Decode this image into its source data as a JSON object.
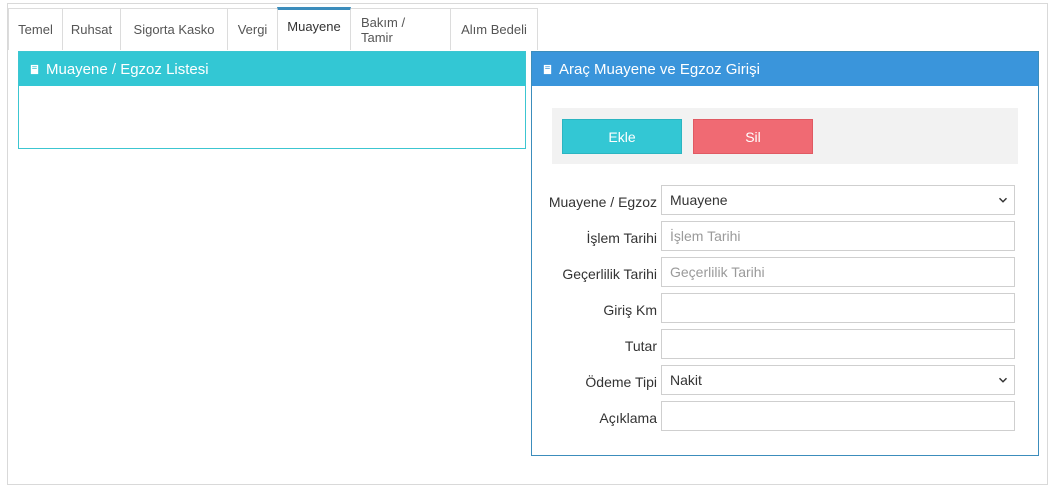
{
  "tabs": [
    "Temel",
    "Ruhsat",
    "Sigorta Kasko",
    "Vergi",
    "Muayene",
    "Bakım / Tamir",
    "Alım Bedeli"
  ],
  "active_tab": "Muayene",
  "list_panel": {
    "title": "Muayene / Egzoz Listesi"
  },
  "form_panel": {
    "title": "Araç Muayene ve Egzoz Girişi",
    "add_label": "Ekle",
    "delete_label": "Sil",
    "fields": {
      "type": {
        "label": "Muayene / Egzoz",
        "value": "Muayene"
      },
      "process_date": {
        "label": "İşlem Tarihi",
        "placeholder": "İşlem Tarihi"
      },
      "validity_date": {
        "label": "Geçerlilik Tarihi",
        "placeholder": "Geçerlilik Tarihi"
      },
      "entry_km": {
        "label": "Giriş Km",
        "value": ""
      },
      "amount": {
        "label": "Tutar",
        "value": ""
      },
      "payment_type": {
        "label": "Ödeme Tipi",
        "value": "Nakit"
      },
      "description": {
        "label": "Açıklama",
        "value": ""
      }
    }
  },
  "colors": {
    "list_header": "#33c7d4",
    "form_header": "#3a95db",
    "add_button": "#33c7d4",
    "delete_button": "#f06a73"
  }
}
